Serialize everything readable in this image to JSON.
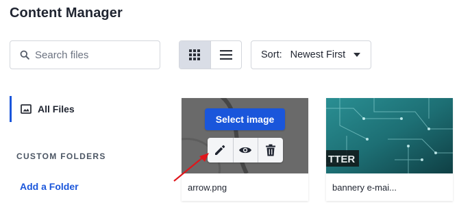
{
  "header": {
    "title": "Content Manager"
  },
  "search": {
    "placeholder": "Search files",
    "value": "",
    "icon": "search-icon"
  },
  "view_toggle": {
    "options": [
      {
        "icon": "grid-icon",
        "active": true
      },
      {
        "icon": "list-icon",
        "active": false
      }
    ]
  },
  "sort": {
    "label": "Sort:",
    "value": "Newest First",
    "icon": "caret-down-icon"
  },
  "sidebar": {
    "all_files": {
      "label": "All Files",
      "icon": "image-icon",
      "active": true
    },
    "folders_heading": "CUSTOM FOLDERS",
    "add_folder_label": "Add a Folder"
  },
  "files": [
    {
      "name": "arrow.png",
      "hovered": true,
      "select_label": "Select image",
      "actions": [
        "edit-icon",
        "view-icon",
        "delete-icon"
      ]
    },
    {
      "name": "bannery e-mai...",
      "thumbnail_text": "TTER"
    }
  ],
  "colors": {
    "accent": "#1a56db",
    "annotation_arrow": "#e0151b",
    "toggle_active_bg": "#d9dde6",
    "text": "#1f2430"
  }
}
